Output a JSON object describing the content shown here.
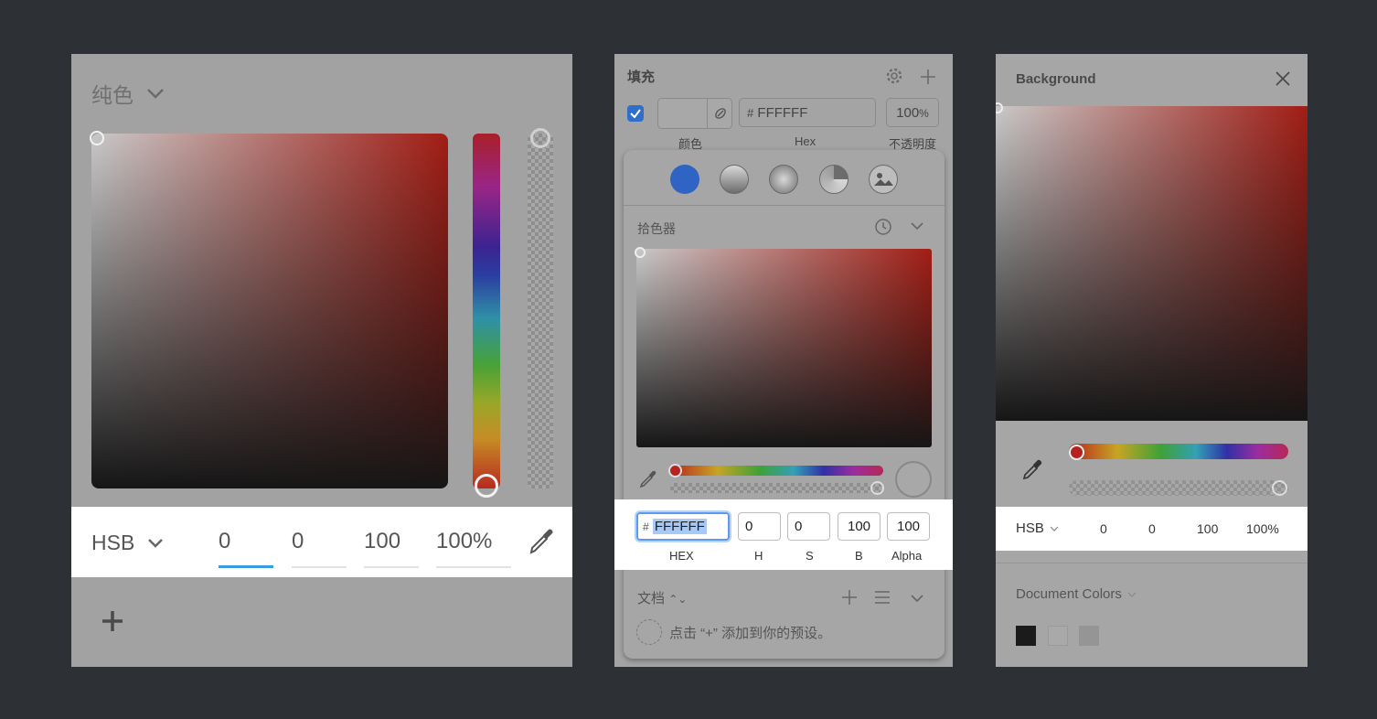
{
  "panel1": {
    "mode_label": "纯色",
    "model": "HSB",
    "values": [
      "0",
      "0",
      "100",
      "100%"
    ]
  },
  "panel2": {
    "title": "填充",
    "hex_value": "FFFFFF",
    "opacity_value": "100",
    "opacity_unit": "%",
    "label_color": "颜色",
    "label_hex": "Hex",
    "label_opacity": "不透明度",
    "picker_label": "拾色器",
    "hex_input": "FFFFFF",
    "fields": [
      {
        "value": "0",
        "label": "H"
      },
      {
        "value": "0",
        "label": "S"
      },
      {
        "value": "100",
        "label": "B"
      },
      {
        "value": "100",
        "label": "Alpha"
      }
    ],
    "hex_label": "HEX",
    "docs_label": "文档",
    "hint": "点击 “+” 添加到你的预设。"
  },
  "panel3": {
    "title": "Background",
    "model": "HSB",
    "values": [
      "0",
      "0",
      "100",
      "100%"
    ],
    "document_colors_label": "Document Colors",
    "swatches": [
      "#1b1b1b",
      "#a8a8a8",
      "#959595"
    ]
  },
  "colors": {
    "background": "#2d3135",
    "panel": "#a2a2a2",
    "accent_blue": "#2f6ecb",
    "focus_blue": "#5b9af0"
  }
}
